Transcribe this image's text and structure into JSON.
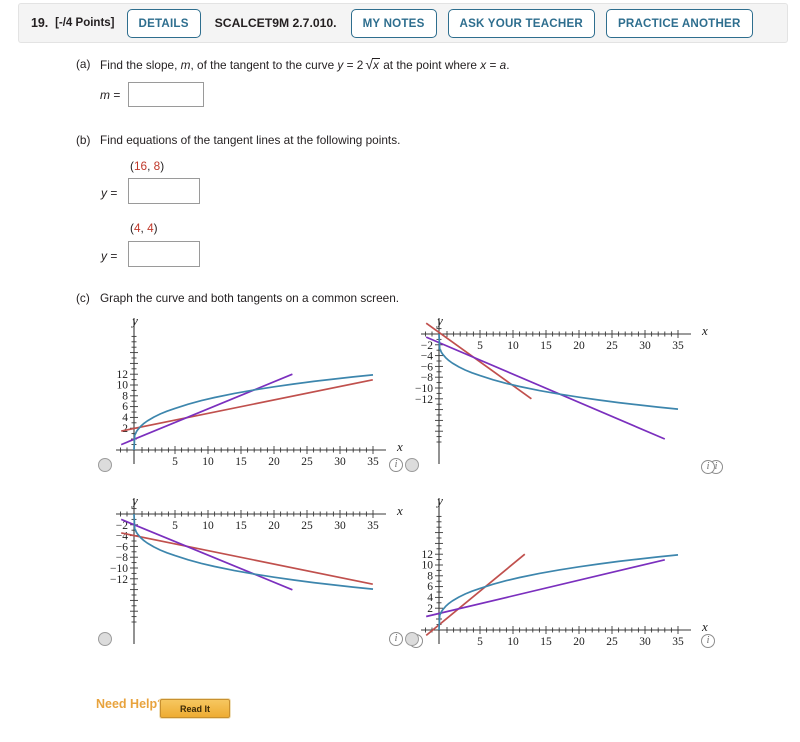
{
  "header": {
    "question_number": "19.",
    "points": "[-/4 Points]",
    "details_label": "DETAILS",
    "textbook_ref": "SCALCET9M 2.7.010.",
    "my_notes_label": "MY NOTES",
    "ask_teacher_label": "ASK YOUR TEACHER",
    "practice_another_label": "PRACTICE ANOTHER",
    "accent_color": "#2e6e8e"
  },
  "parts": {
    "a": {
      "label": "(a)",
      "text_before": "Find the slope,",
      "var_m": "m",
      "text_mid": ", of the tangent to the curve",
      "eq_y": "y",
      "eq_equals": "=",
      "eq_coef": "2",
      "eq_radical": "√",
      "eq_radicand": "x",
      "text_after": "at the point where",
      "eq_x": "x",
      "eq_a": "a",
      "period": ".",
      "answer_label": "m",
      "answer_equals": "=",
      "answer_value": "",
      "answer_placeholder": ""
    },
    "b": {
      "label": "(b)",
      "text": "Find equations of the tangent lines at the following points.",
      "point1": {
        "open": "(",
        "x": "16",
        "comma": ", ",
        "y": "8",
        "close": ")"
      },
      "answer1_label": "y",
      "answer1_equals": "=",
      "answer1_value": "",
      "point2": {
        "open": "(",
        "x": "4",
        "comma": ", ",
        "y": "4",
        "close": ")"
      },
      "answer2_label": "y",
      "answer2_equals": "=",
      "answer2_value": "",
      "point_color": "#c0392b"
    },
    "c": {
      "label": "(c)",
      "text": "Graph the curve and both tangents on a common screen."
    }
  },
  "chart_data": [
    {
      "id": "graph-1",
      "position": "top-left",
      "type": "line",
      "title": "",
      "xlabel": "x",
      "ylabel": "y",
      "xlim": [
        -2,
        37
      ],
      "ylim": [
        -0.6,
        14
      ],
      "xticks": [
        5,
        10,
        15,
        20,
        25,
        30,
        35
      ],
      "yticks": [
        2,
        4,
        6,
        8,
        10,
        12
      ],
      "grid": false,
      "legend": "none",
      "series": [
        {
          "name": "curve",
          "color": "#3d86ad",
          "kind": "sqrt",
          "expr": "y = 2*sqrt(x)",
          "domain": [
            0,
            36
          ]
        },
        {
          "name": "tangent-at-16",
          "color": "#c0504d",
          "kind": "line",
          "slope": 0.25,
          "intercept": 4,
          "domain": [
            -2,
            36
          ]
        },
        {
          "name": "tangent-at-4",
          "color": "#7b2fbe",
          "kind": "line",
          "slope": 0.5,
          "intercept": 2,
          "domain": [
            -2,
            24
          ]
        }
      ],
      "selected": false
    },
    {
      "id": "graph-2",
      "position": "top-right",
      "type": "line",
      "title": "",
      "xlabel": "x",
      "ylabel": "y",
      "xlim": [
        -2,
        37
      ],
      "ylim": [
        -14,
        2.5
      ],
      "xticks": [
        5,
        10,
        15,
        20,
        25,
        30,
        35
      ],
      "yticks": [
        -2,
        -4,
        -6,
        -8,
        -10,
        -12
      ],
      "grid": false,
      "legend": "none",
      "series": [
        {
          "name": "curve",
          "color": "#3d86ad",
          "kind": "sqrt",
          "expr": "y = -2*sqrt(x)",
          "domain": [
            0,
            36
          ]
        },
        {
          "name": "tangent-steep",
          "color": "#c0504d",
          "kind": "line",
          "slope": -1.0,
          "intercept": 2,
          "domain": [
            -2,
            14
          ]
        },
        {
          "name": "tangent-shallow",
          "color": "#7b2fbe",
          "kind": "line",
          "slope": -0.43,
          "intercept": -2,
          "domain": [
            -2,
            33
          ]
        }
      ],
      "selected": false
    },
    {
      "id": "graph-3",
      "position": "bottom-left",
      "type": "line",
      "title": "",
      "xlabel": "x",
      "ylabel": "y",
      "xlim": [
        -2,
        37
      ],
      "ylim": [
        -14,
        2.5
      ],
      "xticks": [
        5,
        10,
        15,
        20,
        25,
        30,
        35
      ],
      "yticks": [
        -2,
        -4,
        -6,
        -8,
        -10,
        -12
      ],
      "grid": false,
      "legend": "none",
      "series": [
        {
          "name": "curve",
          "color": "#3d86ad",
          "kind": "sqrt",
          "expr": "y = -2*sqrt(x)",
          "domain": [
            0,
            36
          ]
        },
        {
          "name": "tangent-at-16",
          "color": "#c0504d",
          "kind": "line",
          "slope": -0.25,
          "intercept": -4,
          "domain": [
            -2,
            36
          ]
        },
        {
          "name": "tangent-at-4",
          "color": "#7b2fbe",
          "kind": "line",
          "slope": -0.5,
          "intercept": -2,
          "domain": [
            -2,
            24
          ]
        }
      ],
      "selected": false
    },
    {
      "id": "graph-4",
      "position": "bottom-right",
      "type": "line",
      "title": "",
      "xlabel": "x",
      "ylabel": "y",
      "xlim": [
        -2,
        37
      ],
      "ylim": [
        -0.6,
        14
      ],
      "xticks": [
        5,
        10,
        15,
        20,
        25,
        30,
        35
      ],
      "yticks": [
        2,
        4,
        6,
        8,
        10,
        12
      ],
      "grid": false,
      "legend": "none",
      "series": [
        {
          "name": "curve",
          "color": "#3d86ad",
          "kind": "sqrt",
          "expr": "y = 2*sqrt(x)",
          "domain": [
            0,
            36
          ]
        },
        {
          "name": "tangent-steep",
          "color": "#c0504d",
          "kind": "line",
          "slope": 1.0,
          "intercept": 1,
          "domain": [
            -2,
            13
          ]
        },
        {
          "name": "tangent-shallow",
          "color": "#7b2fbe",
          "kind": "line",
          "slope": 0.32,
          "intercept": 2.4,
          "domain": [
            -2,
            33
          ]
        }
      ],
      "selected": false
    }
  ],
  "icons": {
    "info_glyph": "i",
    "radio_name": "radio-button"
  },
  "footer": {
    "need_help_label": "Need Help?",
    "read_it_label": "Read It",
    "accent_color": "#e8a33d"
  }
}
